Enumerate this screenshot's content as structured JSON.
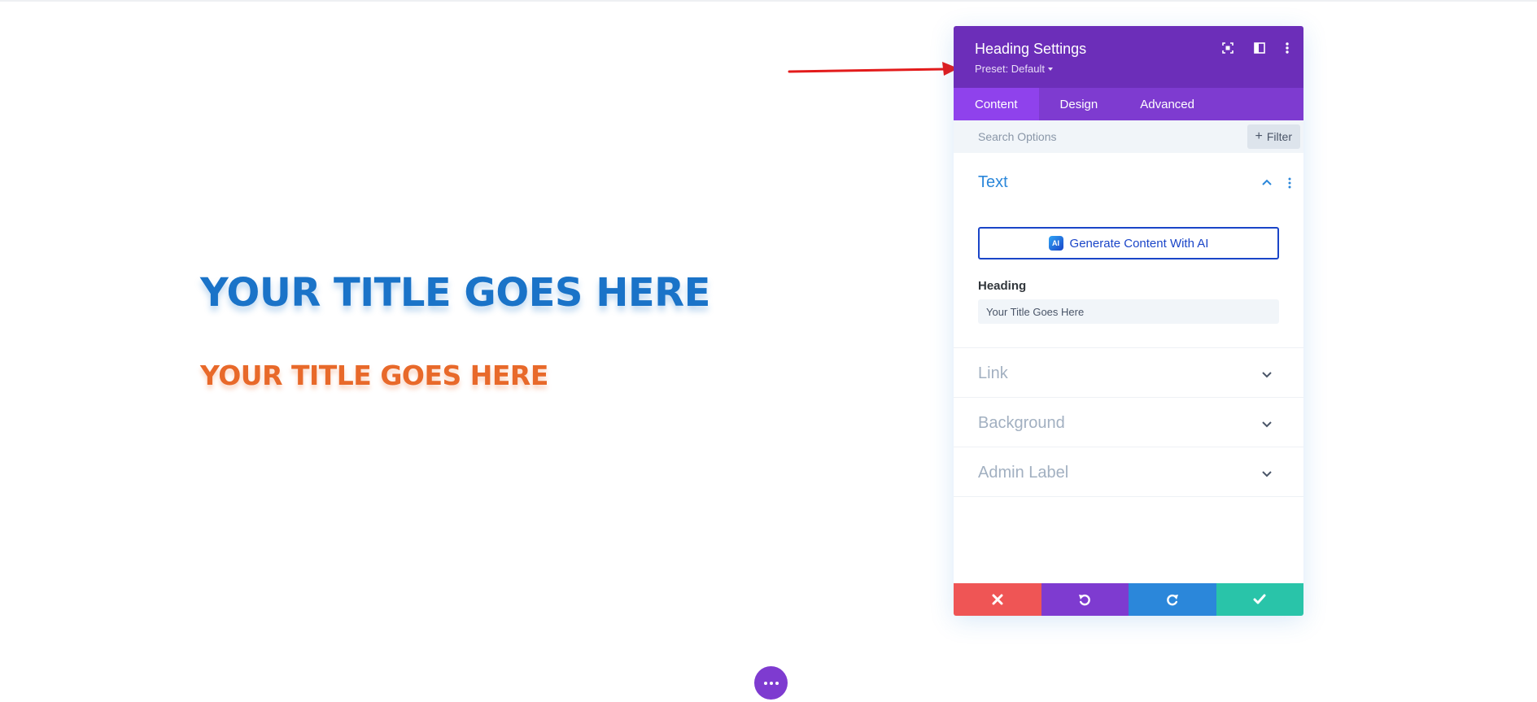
{
  "canvas": {
    "title_primary": "YOUR TITLE GOES HERE",
    "title_secondary": "YOUR TITLE GOES HERE",
    "colors": {
      "blue": "#1a73c8",
      "orange": "#e8692a",
      "annotation_arrow": "#e31b1b"
    }
  },
  "panel": {
    "title": "Heading Settings",
    "preset_label": "Preset: Default",
    "header_icons": [
      "expand-icon",
      "sidebar-toggle-icon",
      "more-vertical-icon"
    ],
    "tabs": [
      {
        "label": "Content",
        "active": true
      },
      {
        "label": "Design",
        "active": false
      },
      {
        "label": "Advanced",
        "active": false
      }
    ],
    "search": {
      "placeholder": "Search Options",
      "filter_label": "Filter"
    },
    "sections": {
      "text": {
        "title": "Text",
        "ai_button_label": "Generate Content With AI",
        "ai_badge": "AI",
        "heading_label": "Heading",
        "heading_value": "Your Title Goes Here"
      },
      "link": {
        "title": "Link"
      },
      "background": {
        "title": "Background"
      },
      "admin_label": {
        "title": "Admin Label"
      }
    },
    "footer": [
      "cancel-icon",
      "undo-icon",
      "redo-icon",
      "save-check-icon"
    ],
    "colors": {
      "header": "#6c2eb9",
      "tabs": "#7e3bd0",
      "active_tab": "#8f42ec",
      "cancel": "#ef5555",
      "undo": "#7e3bd0",
      "redo": "#2b87da",
      "save": "#29c4a9"
    }
  }
}
